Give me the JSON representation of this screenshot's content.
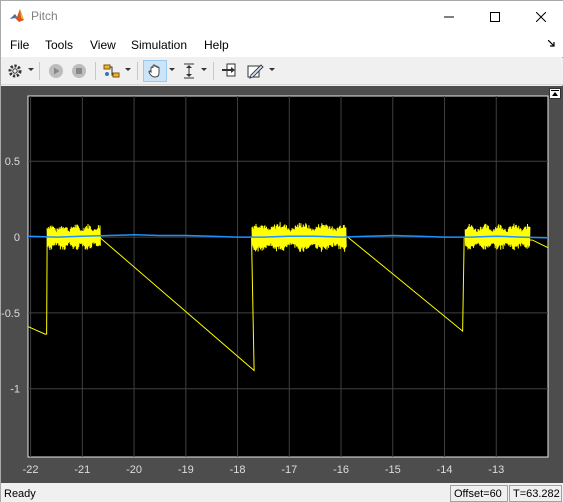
{
  "window": {
    "title": "Pitch"
  },
  "menu": {
    "items": [
      "File",
      "Tools",
      "View",
      "Simulation",
      "Help"
    ]
  },
  "toolbar": {
    "icons": [
      "gear-icon",
      "run-icon",
      "stop-icon",
      "signal-icon",
      "pan-icon",
      "zoom-icon",
      "cursor-icon",
      "style-icon"
    ]
  },
  "status": {
    "text": "Ready",
    "offset": "Offset=60",
    "time": "T=63.282"
  },
  "colors": {
    "plot_background": "#000000",
    "axes_frame": "#4d4d4d",
    "grid": "#404040",
    "series_yellow": "#ffff00",
    "series_blue": "#1e90ff"
  },
  "chart_data": {
    "type": "line",
    "title": "",
    "xlabel": "",
    "ylabel": "",
    "xlim": [
      -22.05,
      -12.0
    ],
    "ylim": [
      -1.45,
      0.93
    ],
    "grid": true,
    "xticks": [
      -22,
      -21,
      -20,
      -19,
      -18,
      -17,
      -16,
      -15,
      -14,
      -13
    ],
    "xtick_labels": [
      "-22",
      "-21",
      "-20",
      "-19",
      "-18",
      "-17",
      "-16",
      "-15",
      "-14",
      "-13"
    ],
    "yticks": [
      0.5,
      0,
      -0.5,
      -1
    ],
    "ytick_labels": [
      "0.5",
      "0",
      "-0.5",
      "-1"
    ],
    "series": [
      {
        "color": "#ffff00",
        "segments": [
          {
            "x": [
              -22.05,
              -21.72,
              -21.69,
              -21.68,
              -20.67,
              -17.68,
              -17.73,
              -17.7,
              -15.87,
              -13.65,
              -13.62,
              -13.6,
              -12.3,
              -12.0
            ],
            "y": [
              -0.59,
              -0.64,
              -0.64,
              0.0,
              0.0,
              -0.88,
              0.0,
              0.0,
              0.0,
              -0.62,
              0.0,
              0.0,
              -0.02,
              -0.07
            ]
          }
        ],
        "bursts": [
          {
            "x_start": -21.68,
            "x_end": -20.65,
            "amplitude": 0.09
          },
          {
            "x_start": -17.72,
            "x_end": -15.9,
            "amplitude": 0.1
          },
          {
            "x_start": -13.6,
            "x_end": -12.35,
            "amplitude": 0.09
          }
        ]
      },
      {
        "color": "#1e90ff",
        "x": [
          -22.05,
          -21.5,
          -21.0,
          -20.5,
          -20.0,
          -19.5,
          -19.0,
          -18.5,
          -18.0,
          -17.5,
          -17.0,
          -16.5,
          -16.0,
          -15.5,
          -15.0,
          -14.5,
          -14.0,
          -13.5,
          -13.0,
          -12.5,
          -12.0
        ],
        "y": [
          0.005,
          0.0,
          0.005,
          0.01,
          0.015,
          0.01,
          0.01,
          0.005,
          0.0,
          0.0,
          0.005,
          0.005,
          0.0,
          0.005,
          0.01,
          0.005,
          0.0,
          0.0,
          0.005,
          0.0,
          -0.005
        ]
      }
    ]
  }
}
